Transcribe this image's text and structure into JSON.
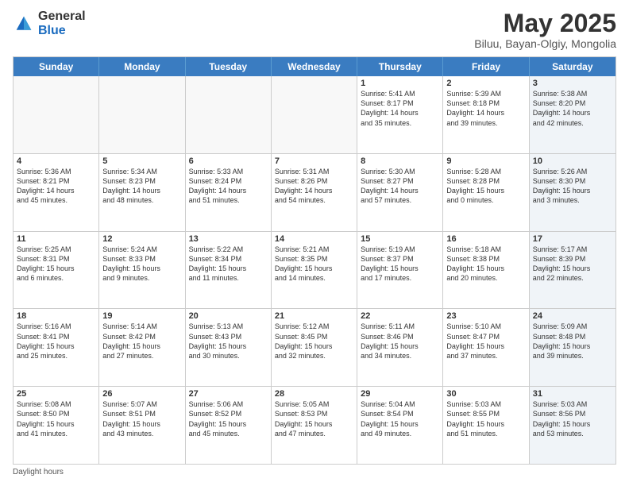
{
  "logo": {
    "general": "General",
    "blue": "Blue"
  },
  "header": {
    "title": "May 2025",
    "subtitle": "Biluu, Bayan-Olgiy, Mongolia"
  },
  "days": [
    "Sunday",
    "Monday",
    "Tuesday",
    "Wednesday",
    "Thursday",
    "Friday",
    "Saturday"
  ],
  "weeks": [
    [
      {
        "day": "",
        "text": "",
        "empty": true
      },
      {
        "day": "",
        "text": "",
        "empty": true
      },
      {
        "day": "",
        "text": "",
        "empty": true
      },
      {
        "day": "",
        "text": "",
        "empty": true
      },
      {
        "day": "1",
        "text": "Sunrise: 5:41 AM\nSunset: 8:17 PM\nDaylight: 14 hours\nand 35 minutes."
      },
      {
        "day": "2",
        "text": "Sunrise: 5:39 AM\nSunset: 8:18 PM\nDaylight: 14 hours\nand 39 minutes."
      },
      {
        "day": "3",
        "text": "Sunrise: 5:38 AM\nSunset: 8:20 PM\nDaylight: 14 hours\nand 42 minutes.",
        "shaded": true
      }
    ],
    [
      {
        "day": "4",
        "text": "Sunrise: 5:36 AM\nSunset: 8:21 PM\nDaylight: 14 hours\nand 45 minutes."
      },
      {
        "day": "5",
        "text": "Sunrise: 5:34 AM\nSunset: 8:23 PM\nDaylight: 14 hours\nand 48 minutes."
      },
      {
        "day": "6",
        "text": "Sunrise: 5:33 AM\nSunset: 8:24 PM\nDaylight: 14 hours\nand 51 minutes."
      },
      {
        "day": "7",
        "text": "Sunrise: 5:31 AM\nSunset: 8:26 PM\nDaylight: 14 hours\nand 54 minutes."
      },
      {
        "day": "8",
        "text": "Sunrise: 5:30 AM\nSunset: 8:27 PM\nDaylight: 14 hours\nand 57 minutes."
      },
      {
        "day": "9",
        "text": "Sunrise: 5:28 AM\nSunset: 8:28 PM\nDaylight: 15 hours\nand 0 minutes."
      },
      {
        "day": "10",
        "text": "Sunrise: 5:26 AM\nSunset: 8:30 PM\nDaylight: 15 hours\nand 3 minutes.",
        "shaded": true
      }
    ],
    [
      {
        "day": "11",
        "text": "Sunrise: 5:25 AM\nSunset: 8:31 PM\nDaylight: 15 hours\nand 6 minutes."
      },
      {
        "day": "12",
        "text": "Sunrise: 5:24 AM\nSunset: 8:33 PM\nDaylight: 15 hours\nand 9 minutes."
      },
      {
        "day": "13",
        "text": "Sunrise: 5:22 AM\nSunset: 8:34 PM\nDaylight: 15 hours\nand 11 minutes."
      },
      {
        "day": "14",
        "text": "Sunrise: 5:21 AM\nSunset: 8:35 PM\nDaylight: 15 hours\nand 14 minutes."
      },
      {
        "day": "15",
        "text": "Sunrise: 5:19 AM\nSunset: 8:37 PM\nDaylight: 15 hours\nand 17 minutes."
      },
      {
        "day": "16",
        "text": "Sunrise: 5:18 AM\nSunset: 8:38 PM\nDaylight: 15 hours\nand 20 minutes."
      },
      {
        "day": "17",
        "text": "Sunrise: 5:17 AM\nSunset: 8:39 PM\nDaylight: 15 hours\nand 22 minutes.",
        "shaded": true
      }
    ],
    [
      {
        "day": "18",
        "text": "Sunrise: 5:16 AM\nSunset: 8:41 PM\nDaylight: 15 hours\nand 25 minutes."
      },
      {
        "day": "19",
        "text": "Sunrise: 5:14 AM\nSunset: 8:42 PM\nDaylight: 15 hours\nand 27 minutes."
      },
      {
        "day": "20",
        "text": "Sunrise: 5:13 AM\nSunset: 8:43 PM\nDaylight: 15 hours\nand 30 minutes."
      },
      {
        "day": "21",
        "text": "Sunrise: 5:12 AM\nSunset: 8:45 PM\nDaylight: 15 hours\nand 32 minutes."
      },
      {
        "day": "22",
        "text": "Sunrise: 5:11 AM\nSunset: 8:46 PM\nDaylight: 15 hours\nand 34 minutes."
      },
      {
        "day": "23",
        "text": "Sunrise: 5:10 AM\nSunset: 8:47 PM\nDaylight: 15 hours\nand 37 minutes."
      },
      {
        "day": "24",
        "text": "Sunrise: 5:09 AM\nSunset: 8:48 PM\nDaylight: 15 hours\nand 39 minutes.",
        "shaded": true
      }
    ],
    [
      {
        "day": "25",
        "text": "Sunrise: 5:08 AM\nSunset: 8:50 PM\nDaylight: 15 hours\nand 41 minutes."
      },
      {
        "day": "26",
        "text": "Sunrise: 5:07 AM\nSunset: 8:51 PM\nDaylight: 15 hours\nand 43 minutes."
      },
      {
        "day": "27",
        "text": "Sunrise: 5:06 AM\nSunset: 8:52 PM\nDaylight: 15 hours\nand 45 minutes."
      },
      {
        "day": "28",
        "text": "Sunrise: 5:05 AM\nSunset: 8:53 PM\nDaylight: 15 hours\nand 47 minutes."
      },
      {
        "day": "29",
        "text": "Sunrise: 5:04 AM\nSunset: 8:54 PM\nDaylight: 15 hours\nand 49 minutes."
      },
      {
        "day": "30",
        "text": "Sunrise: 5:03 AM\nSunset: 8:55 PM\nDaylight: 15 hours\nand 51 minutes."
      },
      {
        "day": "31",
        "text": "Sunrise: 5:03 AM\nSunset: 8:56 PM\nDaylight: 15 hours\nand 53 minutes.",
        "shaded": true
      }
    ]
  ],
  "footer": {
    "note": "Daylight hours"
  }
}
